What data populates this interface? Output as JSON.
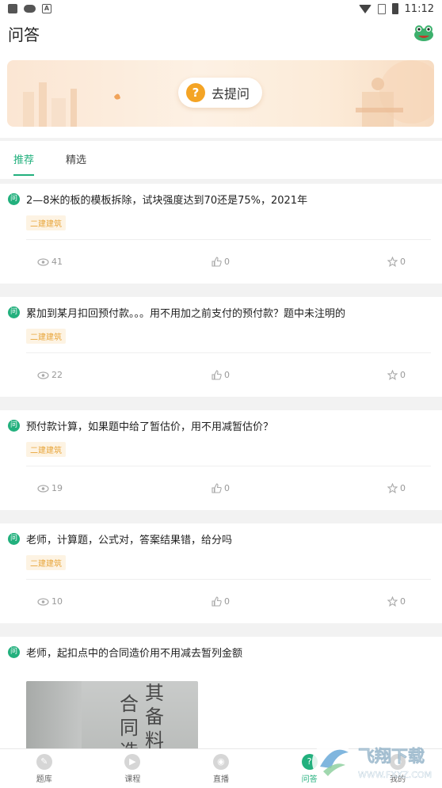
{
  "status_bar": {
    "time": "11:12",
    "app_letter": "A"
  },
  "header": {
    "title": "问答",
    "avatar_icon": "frog-avatar-icon"
  },
  "banner": {
    "ask_icon_glyph": "?",
    "ask_label": "去提问"
  },
  "tabs": [
    {
      "label": "推荐",
      "active": true
    },
    {
      "label": "精选",
      "active": false
    }
  ],
  "questions": [
    {
      "badge": "问",
      "text": "2—8米的板的模板拆除，试块强度达到70还是75%，2021年",
      "tag": "二建建筑",
      "views": "41",
      "likes": "0",
      "favorites": "0"
    },
    {
      "badge": "问",
      "text": "累加到某月扣回预付款。。。用不用加之前支付的预付款？题中未注明的",
      "tag": "二建建筑",
      "views": "22",
      "likes": "0",
      "favorites": "0"
    },
    {
      "badge": "问",
      "text": "预付款计算，如果题中给了暂估价，用不用减暂估价？",
      "tag": "二建建筑",
      "views": "19",
      "likes": "0",
      "favorites": "0"
    },
    {
      "badge": "问",
      "text": "老师，计算题，公式对，答案结果错，给分吗",
      "tag": "二建建筑",
      "views": "10",
      "likes": "0",
      "favorites": "0"
    },
    {
      "badge": "问",
      "text": "老师，起扣点中的合同造价用不用减去暂列金额"
    }
  ],
  "photo_text": {
    "col1": "其备料",
    "col2": "合同造"
  },
  "bottom_nav": [
    {
      "label": "题库",
      "icon": "question-bank-icon",
      "active": false
    },
    {
      "label": "课程",
      "icon": "play-icon",
      "active": false
    },
    {
      "label": "直播",
      "icon": "live-icon",
      "active": false
    },
    {
      "label": "问答",
      "icon": "qa-icon",
      "active": true
    },
    {
      "label": "我的",
      "icon": "profile-icon",
      "active": false
    }
  ],
  "watermark": {
    "text": "飞翔下载",
    "url": "WWW.FXXZ.COM"
  },
  "colors": {
    "accent": "#22b07d",
    "tag": "#e8a53a",
    "ask_icon": "#f4a425"
  }
}
